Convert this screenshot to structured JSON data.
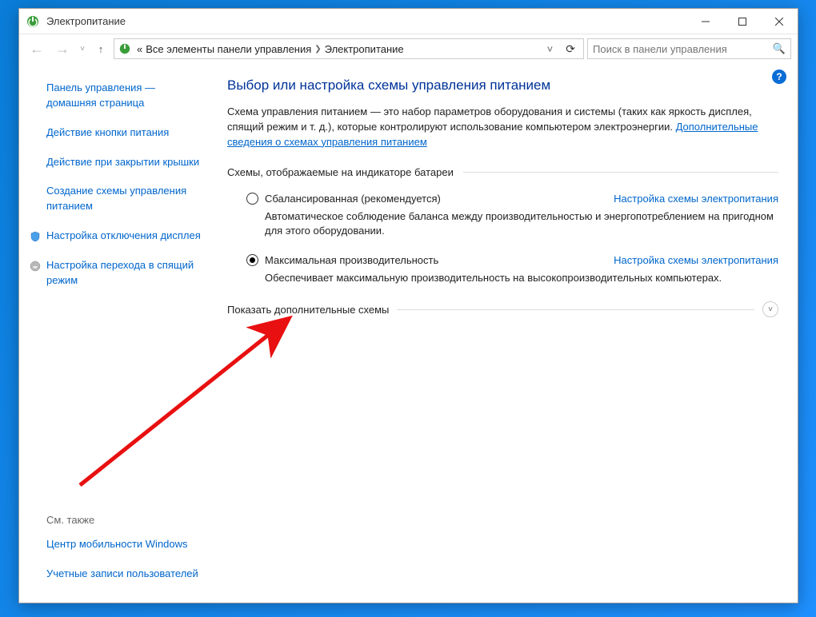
{
  "titlebar": {
    "title": "Электропитание"
  },
  "nav": {
    "breadcrumb_prefix": "«",
    "breadcrumb_parent": "Все элементы панели управления",
    "breadcrumb_current": "Электропитание"
  },
  "search": {
    "placeholder": "Поиск в панели управления"
  },
  "sidebar": {
    "home": "Панель управления — домашняя страница",
    "links": [
      "Действие кнопки питания",
      "Действие при закрытии крышки",
      "Создание схемы управления питанием",
      "Настройка отключения дисплея",
      "Настройка перехода в спящий режим"
    ],
    "see_also_label": "См. также",
    "see_also": [
      "Центр мобильности Windows",
      "Учетные записи пользователей"
    ]
  },
  "main": {
    "heading": "Выбор или настройка схемы управления питанием",
    "description": "Схема управления питанием — это набор параметров оборудования и системы (таких как яркость дисплея, спящий режим и т. д.), которые контролируют использование компьютером электроэнергии. ",
    "description_link": "Дополнительные сведения о схемах управления питанием",
    "group_label": "Схемы, отображаемые на индикаторе батареи",
    "plans": [
      {
        "name": "Сбалансированная (рекомендуется)",
        "selected": false,
        "config_link": "Настройка схемы электропитания",
        "desc": "Автоматическое соблюдение баланса между производительностью и энергопотреблением на пригодном для этого оборудовании."
      },
      {
        "name": "Максимальная производительность",
        "selected": true,
        "config_link": "Настройка схемы электропитания",
        "desc": "Обеспечивает максимальную производительность на высокопроизводительных компьютерах."
      }
    ],
    "expand_label": "Показать дополнительные схемы"
  }
}
